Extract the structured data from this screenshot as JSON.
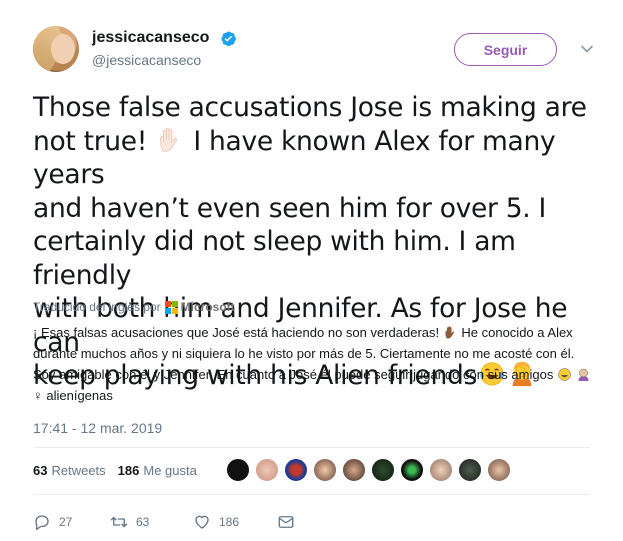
{
  "author": {
    "display_name": "jessicacanseco",
    "handle": "@jessicacanseco",
    "verified": true
  },
  "follow_button_label": "Seguir",
  "tweet_text_lines": [
    "Those false accusations Jose is making are",
    "not true!",
    "I have  known Alex for many years",
    "and haven’t even seen him for over 5. I",
    "certainly did not sleep with him. I am friendly",
    "with both him and Jennifer. As for Jose he can",
    "keep playing with his Alien friends"
  ],
  "translation": {
    "label": "Traducido del inglés por",
    "provider": "Microsoft",
    "text_part1": "¡ Esas falsas acusaciones que José está haciendo no son verdaderas!",
    "text_part2": " He conocido a Alex durante muchos años y ni siquiera lo he visto por más de 5. Ciertamente no me acosté con él. Soy amigable con él y Jennifer. En cuanto a José él puede seguir jugando con sus amigos",
    "text_part3": "♀ alienígenas"
  },
  "timestamp": "17:41 - 12 mar. 2019",
  "stats": {
    "retweets_count": "63",
    "retweets_label": "Retweets",
    "likes_count": "186",
    "likes_label": "Me gusta"
  },
  "actions": {
    "replies": "27",
    "retweets": "63",
    "likes": "186"
  },
  "icons": [
    "verified-badge-icon",
    "chevron-down-icon",
    "raised-hand-icon",
    "tears-of-joy-icon",
    "facepalm-icon",
    "microsoft-logo-icon",
    "reply-icon",
    "retweet-icon",
    "heart-icon",
    "dm-icon"
  ],
  "colors": {
    "follow_accent": "#9b59b6",
    "verified_blue": "#1da1f2",
    "muted_text": "#657786"
  }
}
